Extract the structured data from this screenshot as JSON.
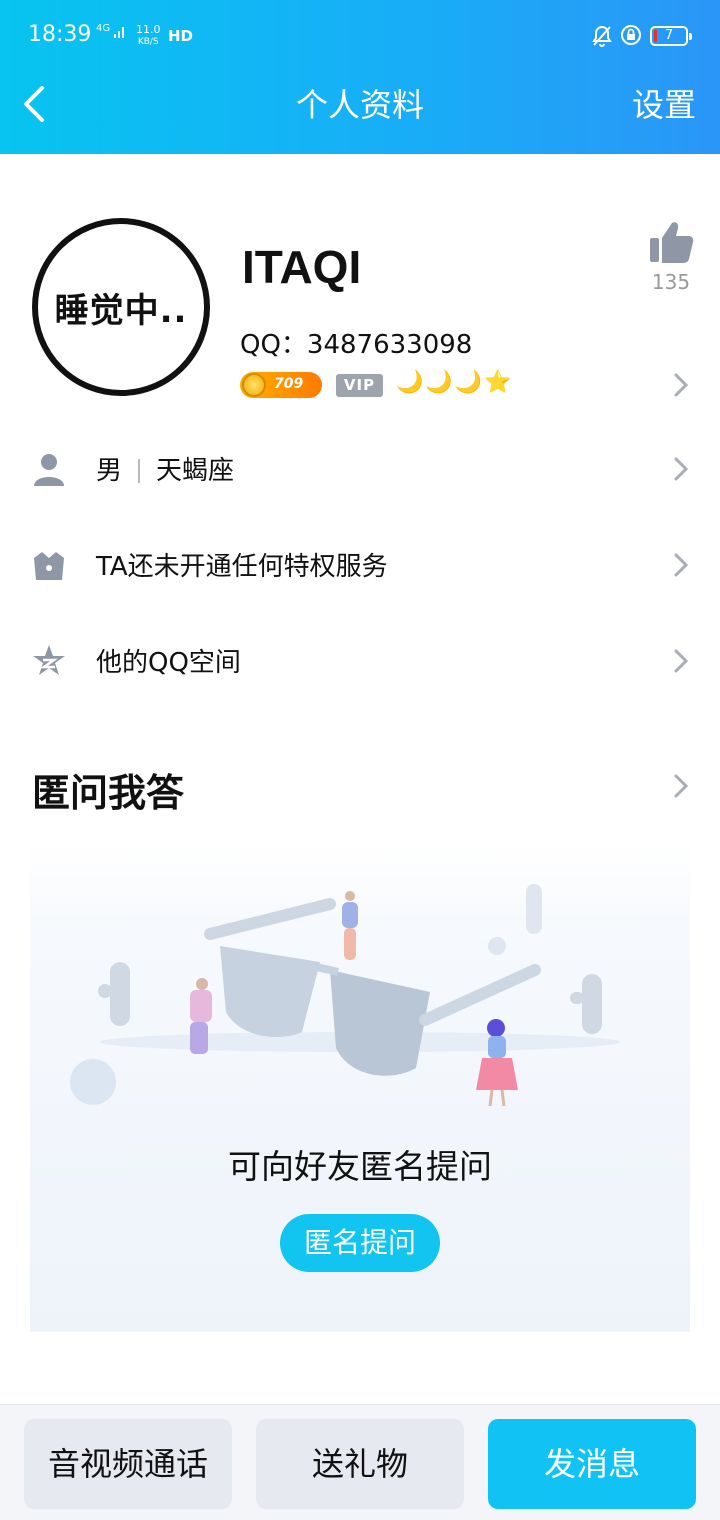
{
  "status_bar": {
    "time": "18:39",
    "network": "4G",
    "speed_value": "11.0",
    "speed_unit": "KB/S",
    "hd": "HD",
    "battery": "7"
  },
  "nav": {
    "title": "个人资料",
    "settings_label": "设置"
  },
  "profile": {
    "avatar_text": "睡觉中..",
    "nickname": "ITAQI",
    "qq_label": "QQ：3487633098",
    "level_badge": "709",
    "vip_label": "VIP",
    "rank_icons": "🌙🌙🌙⭐",
    "likes": "135"
  },
  "rows": {
    "gender": "男",
    "constellation": "天蝎座",
    "privilege": "TA还未开通任何特权服务",
    "qzone": "他的QQ空间"
  },
  "anon_qa": {
    "title": "匿问我答",
    "prompt": "可向好友匿名提问",
    "button": "匿名提问"
  },
  "bottom_bar": {
    "call": "音视频通话",
    "gift": "送礼物",
    "message": "发消息"
  },
  "colors": {
    "header_start": "#07c4f0",
    "header_end": "#2a96f7",
    "accent": "#11c3f5"
  }
}
